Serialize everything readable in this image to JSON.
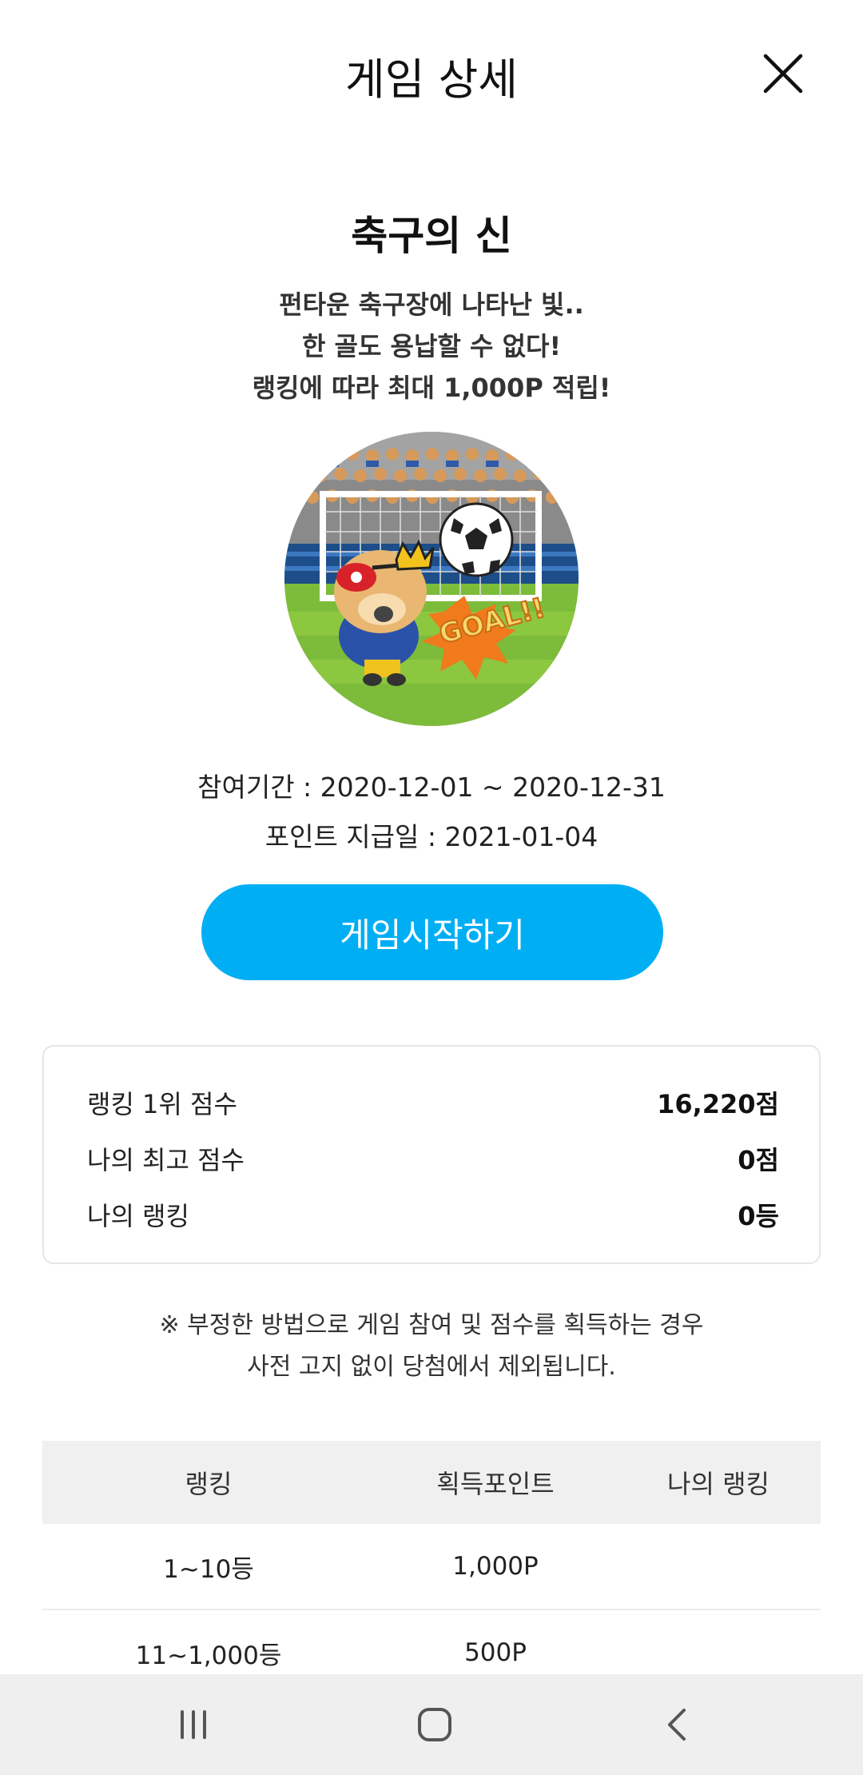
{
  "header": {
    "title": "게임 상세"
  },
  "game": {
    "title": "축구의 신",
    "description": [
      "펀타운 축구장에 나타난 빛..",
      "한 골도 용납할 수 없다!",
      "랭킹에 따라 최대 1,000P 적립!"
    ],
    "image_text": "GOAL!!",
    "period": "참여기간 : 2020-12-01 ~ 2020-12-31",
    "payout_date": "포인트 지급일 : 2021-01-04",
    "start_label": "게임시작하기"
  },
  "scores": [
    {
      "label": "랭킹 1위 점수",
      "value": "16,220점"
    },
    {
      "label": "나의 최고 점수",
      "value": "0점"
    },
    {
      "label": "나의 랭킹",
      "value": "0등"
    }
  ],
  "notice": [
    "※ 부정한 방법으로 게임 참여 및 점수를 획득하는 경우",
    "사전 고지 없이 당첨에서 제외됩니다."
  ],
  "table": {
    "headers": [
      "랭킹",
      "획득포인트",
      "나의 랭킹"
    ],
    "rows": [
      [
        "1~10등",
        "1,000P",
        ""
      ],
      [
        "11~1,000등",
        "500P",
        ""
      ]
    ]
  },
  "colors": {
    "accent": "#00aef4",
    "navbar": "#efefef"
  },
  "icons": {
    "close": "close-icon",
    "recent": "recent-apps-icon",
    "home": "home-icon",
    "back": "back-icon"
  }
}
